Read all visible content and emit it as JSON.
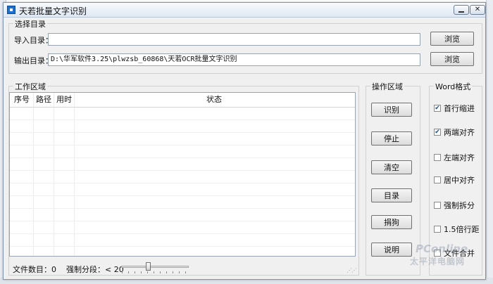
{
  "window": {
    "title": "天若批量文字识别"
  },
  "directory": {
    "group_title": "选择目录",
    "import_label": "导入目录：",
    "import_value": "",
    "output_label": "输出目录：",
    "output_value": "D:\\华军软件3.25\\plwzsb_60868\\天若OCR批量文字识别",
    "browse_label": "浏览"
  },
  "work_area": {
    "group_title": "工作区域",
    "columns": [
      "序号",
      "路径",
      "用时",
      "状态"
    ],
    "rows": []
  },
  "operations": {
    "group_title": "操作区域",
    "buttons": [
      "识别",
      "停止",
      "清空",
      "目录",
      "捐狗",
      "说明"
    ]
  },
  "word_format": {
    "group_title": "Word格式",
    "options": [
      {
        "label": "首行缩进",
        "checked": true
      },
      {
        "label": "两端对齐",
        "checked": true
      },
      {
        "label": "左端对齐",
        "checked": false
      },
      {
        "label": "居中对齐",
        "checked": false
      },
      {
        "label": "强制拆分",
        "checked": false
      },
      {
        "label": "1.5倍行距",
        "checked": false
      },
      {
        "label": "文件合并",
        "checked": false
      }
    ]
  },
  "status_bar": {
    "file_count_label": "文件数目：0",
    "split_label": "强制分段：< 20",
    "slider_value": 20
  },
  "watermark": {
    "line1": "PConline",
    "line2": "太平洋电脑网"
  }
}
